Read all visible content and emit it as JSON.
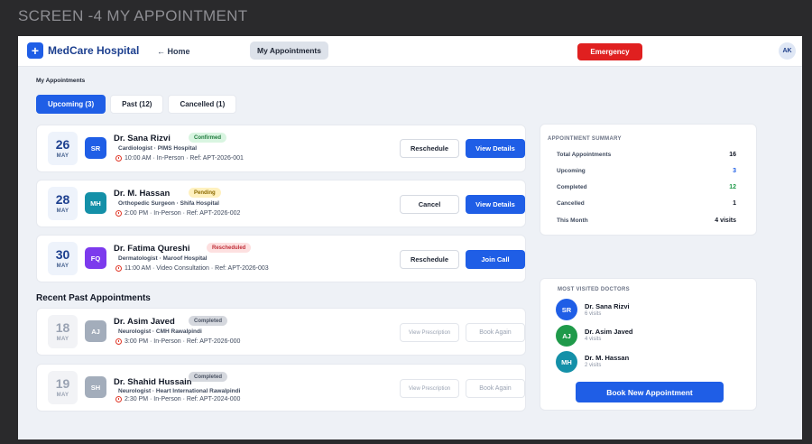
{
  "screen_label": "SCREEN -4 MY APPOINTMENT",
  "navbar": {
    "brand_icon": "+",
    "brand_name": "MedCare Hospital",
    "home_link": "← Home",
    "active_tab": "My Appointments",
    "emergency_label": "Emergency",
    "user_initials": "AK"
  },
  "page": {
    "section_label": "My Appointments",
    "tabs": [
      {
        "label": "Upcoming (3)",
        "active": true
      },
      {
        "label": "Past (12)",
        "active": false
      },
      {
        "label": "Cancelled (1)",
        "active": false
      }
    ],
    "past_heading": "Recent Past Appointments"
  },
  "upcoming": [
    {
      "day": "26",
      "month": "MAY",
      "initials": "SR",
      "avatar_color": "#1f5ee6",
      "doctor": "Dr. Sana Rizvi",
      "specialty": "Cardiologist · PIMS Hospital",
      "meta": "10:00 AM · In-Person · Ref: APT-2026-001",
      "status": "Confirmed",
      "status_type": "confirmed",
      "btn1": "Reschedule",
      "btn2": "View Details"
    },
    {
      "day": "28",
      "month": "MAY",
      "initials": "MH",
      "avatar_color": "#1490a8",
      "doctor": "Dr. M. Hassan",
      "specialty": "Orthopedic Surgeon · Shifa Hospital",
      "meta": "2:00 PM · In-Person · Ref: APT-2026-002",
      "status": "Pending",
      "status_type": "pending",
      "btn1": "Cancel",
      "btn2": "View Details"
    },
    {
      "day": "30",
      "month": "MAY",
      "initials": "FQ",
      "avatar_color": "#7c3aed",
      "doctor": "Dr. Fatima Qureshi",
      "specialty": "Dermatologist · Maroof Hospital",
      "meta": "11:00 AM · Video Consultation · Ref: APT-2026-003",
      "status": "Rescheduled",
      "status_type": "rescheduled",
      "btn1": "Reschedule",
      "btn2": "Join Call"
    }
  ],
  "past": [
    {
      "day": "18",
      "month": "MAY",
      "initials": "AJ",
      "avatar_color": "#a3adbb",
      "doctor": "Dr. Asim Javed",
      "specialty": "Neurologist · CMH Rawalpindi",
      "meta": "3:00 PM · In-Person · Ref: APT-2026-000",
      "status": "Completed",
      "btn1": "View Prescription",
      "btn2": "Book Again"
    },
    {
      "day": "19",
      "month": "MAY",
      "initials": "SH",
      "avatar_color": "#a3adbb",
      "doctor": "Dr. Shahid Hussain",
      "specialty": "Neurologist · Heart International Rawalpindi",
      "meta": "2:30 PM · In-Person · Ref: APT-2024-000",
      "status": "Completed",
      "btn1": "View Prescription",
      "btn2": "Book Again"
    }
  ],
  "summary": {
    "title": "APPOINTMENT SUMMARY",
    "rows": [
      {
        "label": "Total Appointments",
        "value": "16",
        "color": "#121826"
      },
      {
        "label": "Upcoming",
        "value": "3",
        "color": "#1f5ee6"
      },
      {
        "label": "Completed",
        "value": "12",
        "color": "#1f9a4a"
      },
      {
        "label": "Cancelled",
        "value": "1",
        "color": "#121826"
      },
      {
        "label": "This Month",
        "value": "4 visits",
        "color": "#121826"
      }
    ]
  },
  "most_visited": {
    "title": "MOST VISITED DOCTORS",
    "doctors": [
      {
        "initials": "SR",
        "color": "#1f5ee6",
        "name": "Dr. Sana Rizvi",
        "visits": "6 visits"
      },
      {
        "initials": "AJ",
        "color": "#1f9a4a",
        "name": "Dr. Asim Javed",
        "visits": "4 visits"
      },
      {
        "initials": "MH",
        "color": "#1490a8",
        "name": "Dr. M. Hassan",
        "visits": "2 visits"
      }
    ],
    "book_button": "Book New Appointment"
  },
  "icons": {
    "clock": "alarm-clock-icon"
  }
}
